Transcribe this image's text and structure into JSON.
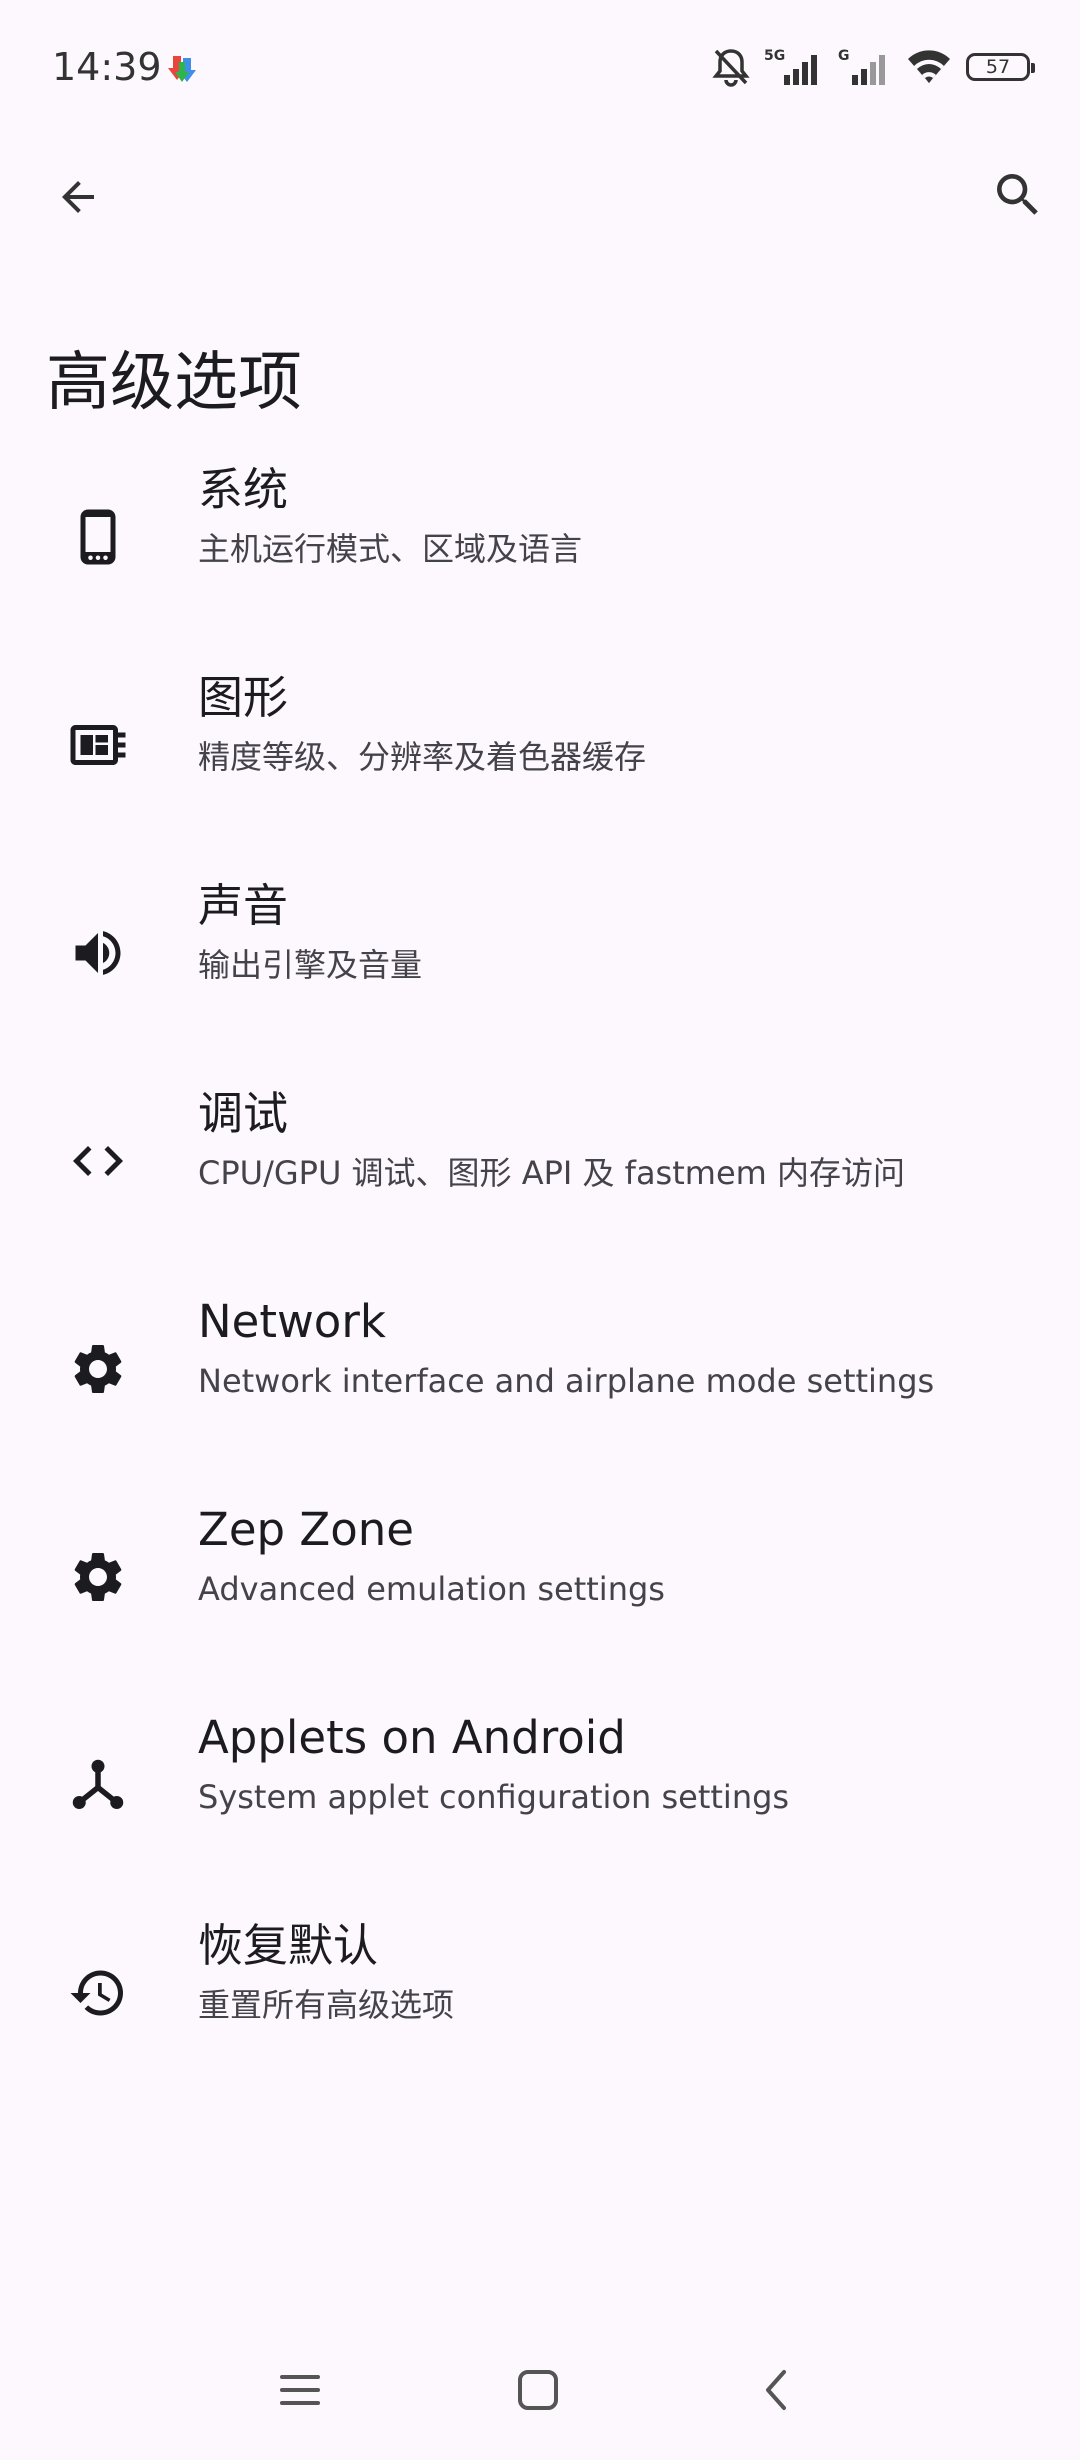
{
  "status_bar": {
    "time": "14:39",
    "battery": "57",
    "icons": [
      "app-download-icon",
      "silent-mode-icon",
      "signal-5g-icon",
      "signal-g-icon",
      "wifi-icon",
      "battery-icon"
    ],
    "signal_labels": {
      "sim1": "5G",
      "sim2": "G"
    }
  },
  "top_bar": {
    "back_icon": "arrow-left-icon",
    "search_icon": "search-icon"
  },
  "page": {
    "title": "高级选项"
  },
  "settings": [
    {
      "icon": "phone-icon",
      "title": "系统",
      "subtitle": "主机运行模式、区域及语言"
    },
    {
      "icon": "graphics-chip-icon",
      "title": "图形",
      "subtitle": "精度等级、分辨率及着色器缓存"
    },
    {
      "icon": "speaker-icon",
      "title": "声音",
      "subtitle": "输出引擎及音量"
    },
    {
      "icon": "code-icon",
      "title": "调试",
      "subtitle": "CPU/GPU 调试、图形 API 及 fastmem 内存访问"
    },
    {
      "icon": "gear-icon",
      "title": "Network",
      "subtitle": "Network interface and airplane mode settings"
    },
    {
      "icon": "gear-icon",
      "title": "Zep Zone",
      "subtitle": "Advanced emulation settings"
    },
    {
      "icon": "share-nodes-icon",
      "title": "Applets on Android",
      "subtitle": "System applet configuration settings"
    },
    {
      "icon": "history-icon",
      "title": "恢复默认",
      "subtitle": "重置所有高级选项"
    }
  ],
  "nav_bar": {
    "icons": [
      "menu-icon",
      "home-square-icon",
      "back-chevron-icon"
    ]
  },
  "colors": {
    "background": "#fdf8fd",
    "text_primary": "#1c1b1f",
    "text_secondary": "#45434a"
  }
}
